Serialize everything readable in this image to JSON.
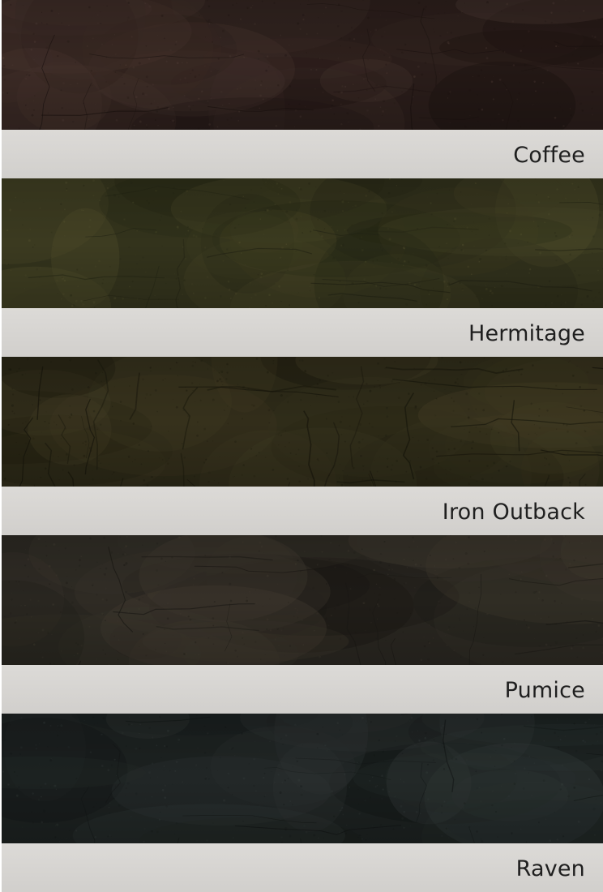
{
  "swatches": [
    {
      "name": "Coffee",
      "icon": "leather-coffee-swatch",
      "colors": {
        "base": "#2a1d1a",
        "mid": "#3a2a25",
        "light": "#473630",
        "dark": "#1c1210",
        "grain": "#5a463e"
      }
    },
    {
      "name": "Hermitage",
      "icon": "leather-hermitage-swatch",
      "colors": {
        "base": "#33331c",
        "mid": "#3e3d22",
        "light": "#4c4a2a",
        "dark": "#232414",
        "grain": "#5d5a34"
      }
    },
    {
      "name": "Iron Outback",
      "icon": "leather-iron-outback-swatch",
      "colors": {
        "base": "#2d2a18",
        "mid": "#36321d",
        "light": "#433d24",
        "dark": "#1b190d",
        "grain": "#15140a"
      }
    },
    {
      "name": "Pumice",
      "icon": "leather-pumice-swatch",
      "colors": {
        "base": "#2a2721",
        "mid": "#36312a",
        "light": "#403a2f",
        "dark": "#1a1814",
        "grain": "#4a4336"
      }
    },
    {
      "name": "Raven",
      "icon": "leather-raven-swatch",
      "colors": {
        "base": "#1c2120",
        "mid": "#252b2a",
        "light": "#313837",
        "dark": "#121615",
        "grain": "#3c4443"
      }
    }
  ]
}
